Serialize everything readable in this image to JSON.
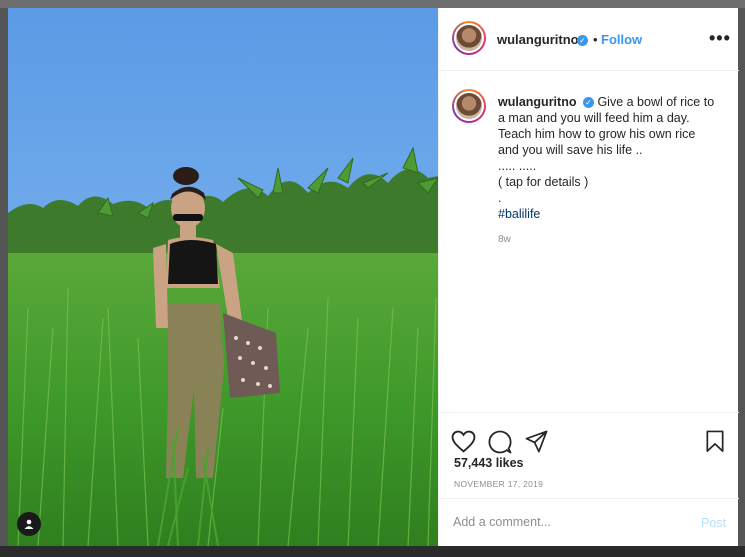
{
  "post": {
    "username": "wulanguritno",
    "verified_glyph": "✓",
    "dot_separator": "•",
    "follow_label": "Follow",
    "more_label": "•••",
    "caption_lines": [
      "Give a bowl of rice to",
      "a man and you will feed him a day.",
      "Teach him how to grow his own rice",
      "and you will save his life ..",
      "..... .....",
      "( tap for details )",
      "."
    ],
    "hashtag": "#balilife",
    "relative_time": "8w",
    "likes": "57,443 likes",
    "date": "NOVEMBER 17, 2019",
    "comment_placeholder": "Add a comment...",
    "post_label": "Post"
  },
  "icons": {
    "like": "heart-icon",
    "comment": "comment-bubble-icon",
    "share": "paper-plane-icon",
    "save": "bookmark-icon",
    "tag": "user-tag-icon"
  },
  "colors": {
    "accent": "#3897f0",
    "hashtag": "#00376b",
    "post_disabled": "#b2dffc"
  }
}
